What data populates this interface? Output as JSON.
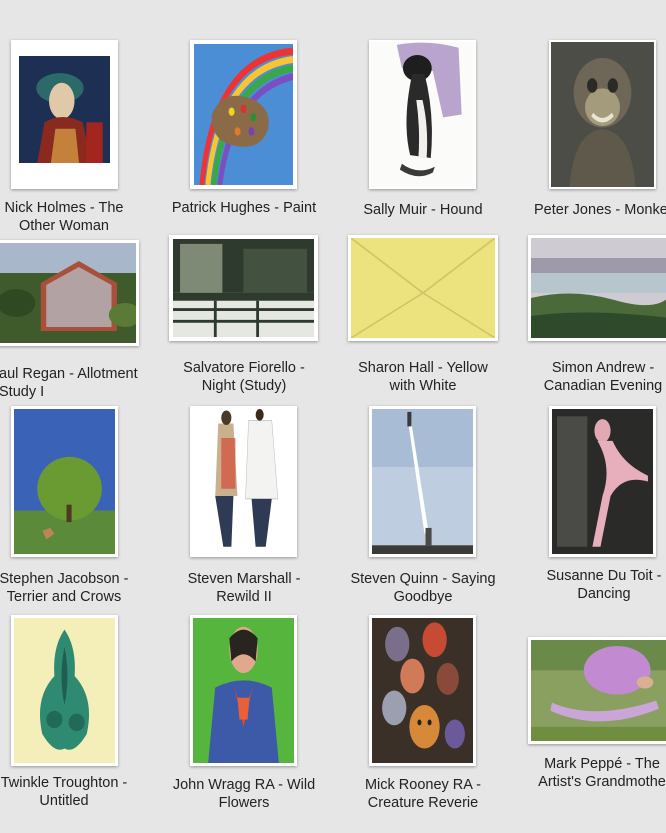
{
  "artworks": [
    {
      "artist": "Nick Holmes",
      "title": "The Other Woman",
      "caption": "Nick Holmes - The\nOther Woman"
    },
    {
      "artist": "Patrick Hughes",
      "title": "Paint",
      "caption": "Patrick Hughes - Paint"
    },
    {
      "artist": "Sally Muir",
      "title": "Hound",
      "caption": "Sally Muir - Hound"
    },
    {
      "artist": "Peter Jones",
      "title": "Monke",
      "caption": "Peter Jones - Monke"
    },
    {
      "artist": "aul Regan",
      "title": "Allotment Study I",
      "caption": "aul Regan - Allotment\nStudy I"
    },
    {
      "artist": "Salvatore Fiorello",
      "title": "Night (Study)",
      "caption": "Salvatore Fiorello -\nNight (Study)"
    },
    {
      "artist": "Sharon Hall",
      "title": "Yellow with White",
      "caption": "Sharon Hall - Yellow\nwith White"
    },
    {
      "artist": "Simon Andrew",
      "title": "Canadian Evening",
      "caption": "Simon Andrew -\nCanadian Evening"
    },
    {
      "artist": "Stephen Jacobson",
      "title": "Terrier and Crows",
      "caption": "Stephen Jacobson -\nTerrier and Crows"
    },
    {
      "artist": "Steven Marshall",
      "title": "Rewild II",
      "caption": "Steven Marshall -\nRewild II"
    },
    {
      "artist": "Steven Quinn",
      "title": "Saying Goodbye",
      "caption": "Steven Quinn - Saying\nGoodbye"
    },
    {
      "artist": "Susanne Du Toit",
      "title": "Dancing",
      "caption": "Susanne Du Toit -\nDancing"
    },
    {
      "artist": "Twinkle Troughton",
      "title": "Untitled",
      "caption": "Twinkle Troughton -\nUntitled"
    },
    {
      "artist": "John Wragg RA",
      "title": "Wild Flowers",
      "caption": "John Wragg RA - Wild\nFlowers"
    },
    {
      "artist": "Mick Rooney RA",
      "title": "Creature Reverie",
      "caption": "Mick Rooney RA -\nCreature Reverie"
    },
    {
      "artist": "Mark Peppé",
      "title": "The Artist's Grandmothe",
      "caption": "Mark Peppé - The\nArtist's Grandmothe"
    }
  ]
}
